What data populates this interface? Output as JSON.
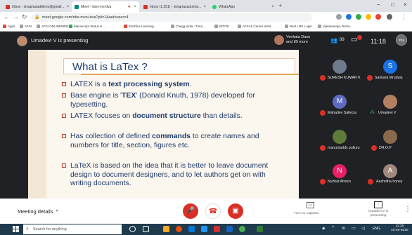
{
  "browser": {
    "tabs": [
      {
        "label": "Inbox - sivaprasaddemo@gmail...",
        "color": "#d93025"
      },
      {
        "label": "Meet - nbs-rvrs-dva",
        "color": "#00897b"
      },
      {
        "label": "Inbox (1,251) - sivaprasadumar...",
        "color": "#d93025"
      },
      {
        "label": "WhatsApp",
        "color": "#25d366"
      }
    ],
    "url": "meet.google.com/nbs-mvsi-dva?pli=1&authuser=4",
    "bookmarks": [
      "Apps",
      "AFSI",
      "AFSI ONLINEWEB",
      "Manuscript Status &...",
      "EduPlus Learning...",
      "Chegg India - Tutor...",
      "IRDTE",
      "AFSI & Career Instit...",
      "Best LMS Login",
      "Vijetavanaya Techn..."
    ]
  },
  "meet": {
    "presenting_text": "Umadevi V is presenting",
    "others_label": "Venkata Dasu",
    "others_count": "and 89 more",
    "participant_count": "89",
    "time": "11:18",
    "you_label": "You",
    "participants": [
      {
        "name": "SURESH KUMAR K",
        "initial": "",
        "color": "#6d7b8d"
      },
      {
        "name": "Sankara Mrudula",
        "initial": "S",
        "color": "#1a73e8"
      },
      {
        "name": "Mahadev Sallecia",
        "initial": "M",
        "color": "#5c6bc0"
      },
      {
        "name": "Umadevi V",
        "initial": "",
        "color": "#b08060"
      },
      {
        "name": "manumaddy pulluru",
        "initial": "",
        "color": "#5e7b3a"
      },
      {
        "name": "DR.O.P",
        "initial": "",
        "color": "#8a6a4a"
      },
      {
        "name": "Nuzhat Afreen",
        "initial": "N",
        "color": "#e91e63"
      },
      {
        "name": "Aashritha honey",
        "initial": "A",
        "color": "#a1887f"
      }
    ]
  },
  "slide": {
    "title": "What is LaTex ?",
    "bullets": [
      {
        "pre": "LATEX is a ",
        "bold": "text processing system",
        "post": "."
      },
      {
        "pre": "Base engine is '",
        "bold": "TEX",
        "post": "' (Donald Knuth, 1978) developed for typesetting."
      },
      {
        "pre": "LATEX focuses on ",
        "bold": "document structure",
        "post": " than details."
      },
      {
        "pre": "Has collection of defined ",
        "bold": "commands",
        "post": " to create names and numbers for title, section, figures etc."
      },
      {
        "pre": "LaTeX is based on the idea that it is better to leave document design to document designers, and to let authors get on with writing documents.",
        "bold": "",
        "post": ""
      }
    ]
  },
  "controls": {
    "meeting_details": "Meeting details",
    "captions_label": "Turn on captions",
    "presenting_label": "Umadevi V is presenting"
  },
  "taskbar": {
    "search_placeholder": "Search for anything",
    "time": "11:18",
    "date": "10-03-2020"
  }
}
